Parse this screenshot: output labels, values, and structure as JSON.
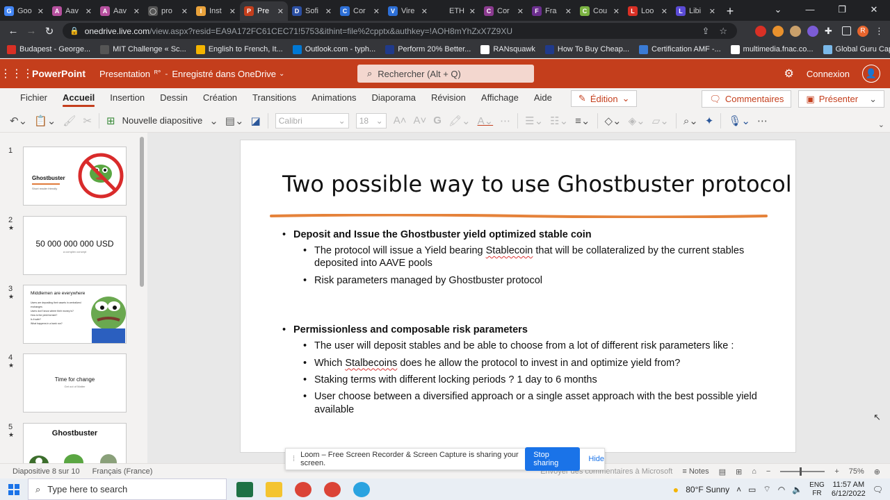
{
  "browser": {
    "tabs": [
      {
        "label": "Goo",
        "color": "#4285f4",
        "glyph": "G"
      },
      {
        "label": "Aav",
        "color": "#b6509e",
        "glyph": "A"
      },
      {
        "label": "Aav",
        "color": "#b6509e",
        "glyph": "A"
      },
      {
        "label": "pro",
        "color": "#555555",
        "glyph": "◯"
      },
      {
        "label": "Inst",
        "color": "#e9a23b",
        "glyph": "I"
      },
      {
        "label": "Pre",
        "color": "#c43e1c",
        "glyph": "P",
        "active": true
      },
      {
        "label": "Sofi",
        "color": "#2b4fa3",
        "glyph": "D"
      },
      {
        "label": "Cor",
        "color": "#2d6fd6",
        "glyph": "C"
      },
      {
        "label": "Vire",
        "color": "#2d6fd6",
        "glyph": "V"
      },
      {
        "label": "ETH",
        "color": "#202124",
        "glyph": ""
      },
      {
        "label": "Cor",
        "color": "#8b3a8f",
        "glyph": "C"
      },
      {
        "label": "Fra",
        "color": "#6b2e8e",
        "glyph": "F"
      },
      {
        "label": "Cou",
        "color": "#7bb342",
        "glyph": "C"
      },
      {
        "label": "Loo",
        "color": "#d93025",
        "glyph": "L"
      },
      {
        "label": "Libi",
        "color": "#5b4bd6",
        "glyph": "L"
      }
    ],
    "new_tab": "+",
    "url_host": "onedrive.live.com",
    "url_path": "/view.aspx?resid=EA9A172FC61CEC71!5753&ithint=file%2cpptx&authkey=!AOH8mYhZxX7Z9XU",
    "bookmarks": [
      {
        "label": "Budapest - George...",
        "color": "#d93025"
      },
      {
        "label": "MIT Challenge « Sc...",
        "color": "#555555"
      },
      {
        "label": "English to French, It...",
        "color": "#f4b400"
      },
      {
        "label": "Outlook.com - typh...",
        "color": "#0078d4"
      },
      {
        "label": "Perform 20% Better...",
        "color": "#203a8a"
      },
      {
        "label": "RANsquawk",
        "color": "#ffffff"
      },
      {
        "label": "How To Buy Cheap...",
        "color": "#203a8a"
      },
      {
        "label": "Certification AMF -...",
        "color": "#3a7bd5"
      },
      {
        "label": "multimedia.fnac.co...",
        "color": "#ffffff"
      },
      {
        "label": "Global Guru Capital...",
        "color": "#7ab8e8"
      }
    ]
  },
  "app": {
    "name": "PowerPoint",
    "doc_title": "Presentation",
    "save_status": "Enregistré dans OneDrive",
    "search_placeholder": "Rechercher (Alt + Q)",
    "signin": "Connexion",
    "accent": "#c43e1c"
  },
  "ribbon": {
    "tabs": [
      "Fichier",
      "Accueil",
      "Insertion",
      "Dessin",
      "Création",
      "Transitions",
      "Animations",
      "Diaporama",
      "Révision",
      "Affichage",
      "Aide"
    ],
    "active_tab": "Accueil",
    "edit_mode": "Édition",
    "comments": "Commentaires",
    "present": "Présenter",
    "new_slide": "Nouvelle diapositive",
    "font": "Calibri",
    "font_size": "18"
  },
  "thumbnails": [
    {
      "num": "1",
      "star": "",
      "title": "Ghostbuster",
      "subtitle": "Short reader friendly"
    },
    {
      "num": "2",
      "star": "★",
      "title": "50 000 000 000 USD",
      "subtitle": "a complex concept"
    },
    {
      "num": "3",
      "star": "★",
      "title": "Middlemen are everywhere",
      "bullets": [
        "Users are depositing their assets in centralized exchanges",
        "Users don't know where their money is?",
        "How is the yield formed?",
        "Is it safe?",
        "What happens in a bank run?"
      ]
    },
    {
      "num": "4",
      "star": "★",
      "title": "Time for change",
      "subtitle": "Get out of Matter"
    },
    {
      "num": "5",
      "star": "★",
      "title": "Ghostbuster",
      "subtitle": ""
    }
  ],
  "slide": {
    "title": "Two possible way to use Ghostbuster protocol",
    "sections": [
      {
        "heading": "Deposit and Issue the Ghostbuster yield optimized stable coin",
        "items": [
          "The protocol will issue a Yield bearing Stablecoin that will be collateralized by the current stables deposited into AAVE pools",
          "Risk parameters managed by Ghostbuster protocol"
        ]
      },
      {
        "heading": "Permissionless and composable risk parameters",
        "items": [
          "The user will deposit stables and be able to choose from a lot of different risk parameters like :",
          "Which Stalbecoins does he allow the protocol to invest in and optimize yield from?",
          "Staking terms with different locking periods ? 1 day to 6 months",
          "User choose between a diversified approach or a single asset approach with the best possible yield available"
        ]
      }
    ]
  },
  "loom": {
    "message": "Loom – Free Screen Recorder & Screen Capture is sharing your screen.",
    "stop": "Stop sharing",
    "hide": "Hide"
  },
  "statusbar": {
    "slide_pos": "Diapositive 8 sur 10",
    "language": "Français (France)",
    "feedback": "Envoyer des commentaires à Microsoft",
    "notes": "Notes",
    "zoom": "75%"
  },
  "taskbar": {
    "search_placeholder": "Type here to search",
    "weather": "80°F  Sunny",
    "lang_top": "ENG",
    "lang_bottom": "FR",
    "time": "11:57 AM",
    "date": "6/12/2022"
  }
}
